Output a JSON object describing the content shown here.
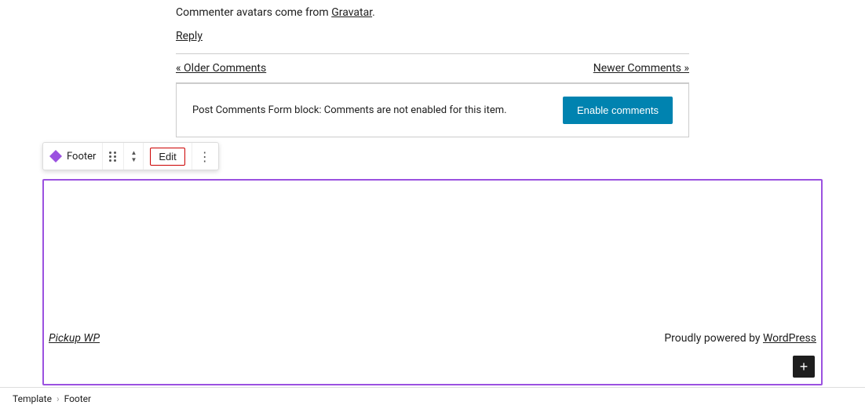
{
  "main": {
    "gravatar_text": "Commenter avatars come from",
    "gravatar_link": "Gravatar",
    "gravatar_period": ".",
    "reply_label": "Reply",
    "older_comments": "« Older Comments",
    "newer_comments": "Newer Comments »",
    "comment_form_notice": "Post Comments Form block: Comments are not enabled for this item.",
    "enable_comments_btn": "Enable comments"
  },
  "toolbar": {
    "block_label": "Footer",
    "edit_label": "Edit",
    "drag_icon": "drag-icon",
    "arrows_icon": "arrows-icon",
    "more_icon": "more-options-icon"
  },
  "footer": {
    "site_name": "Pickup WP",
    "powered_text": "Proudly powered by",
    "powered_link": "WordPress",
    "plus_label": "+"
  },
  "breadcrumb": {
    "template": "Template",
    "separator": "›",
    "footer": "Footer"
  },
  "colors": {
    "purple_border": "#9b51e0",
    "edit_red": "#c00",
    "enable_btn_blue": "#0083b0"
  }
}
